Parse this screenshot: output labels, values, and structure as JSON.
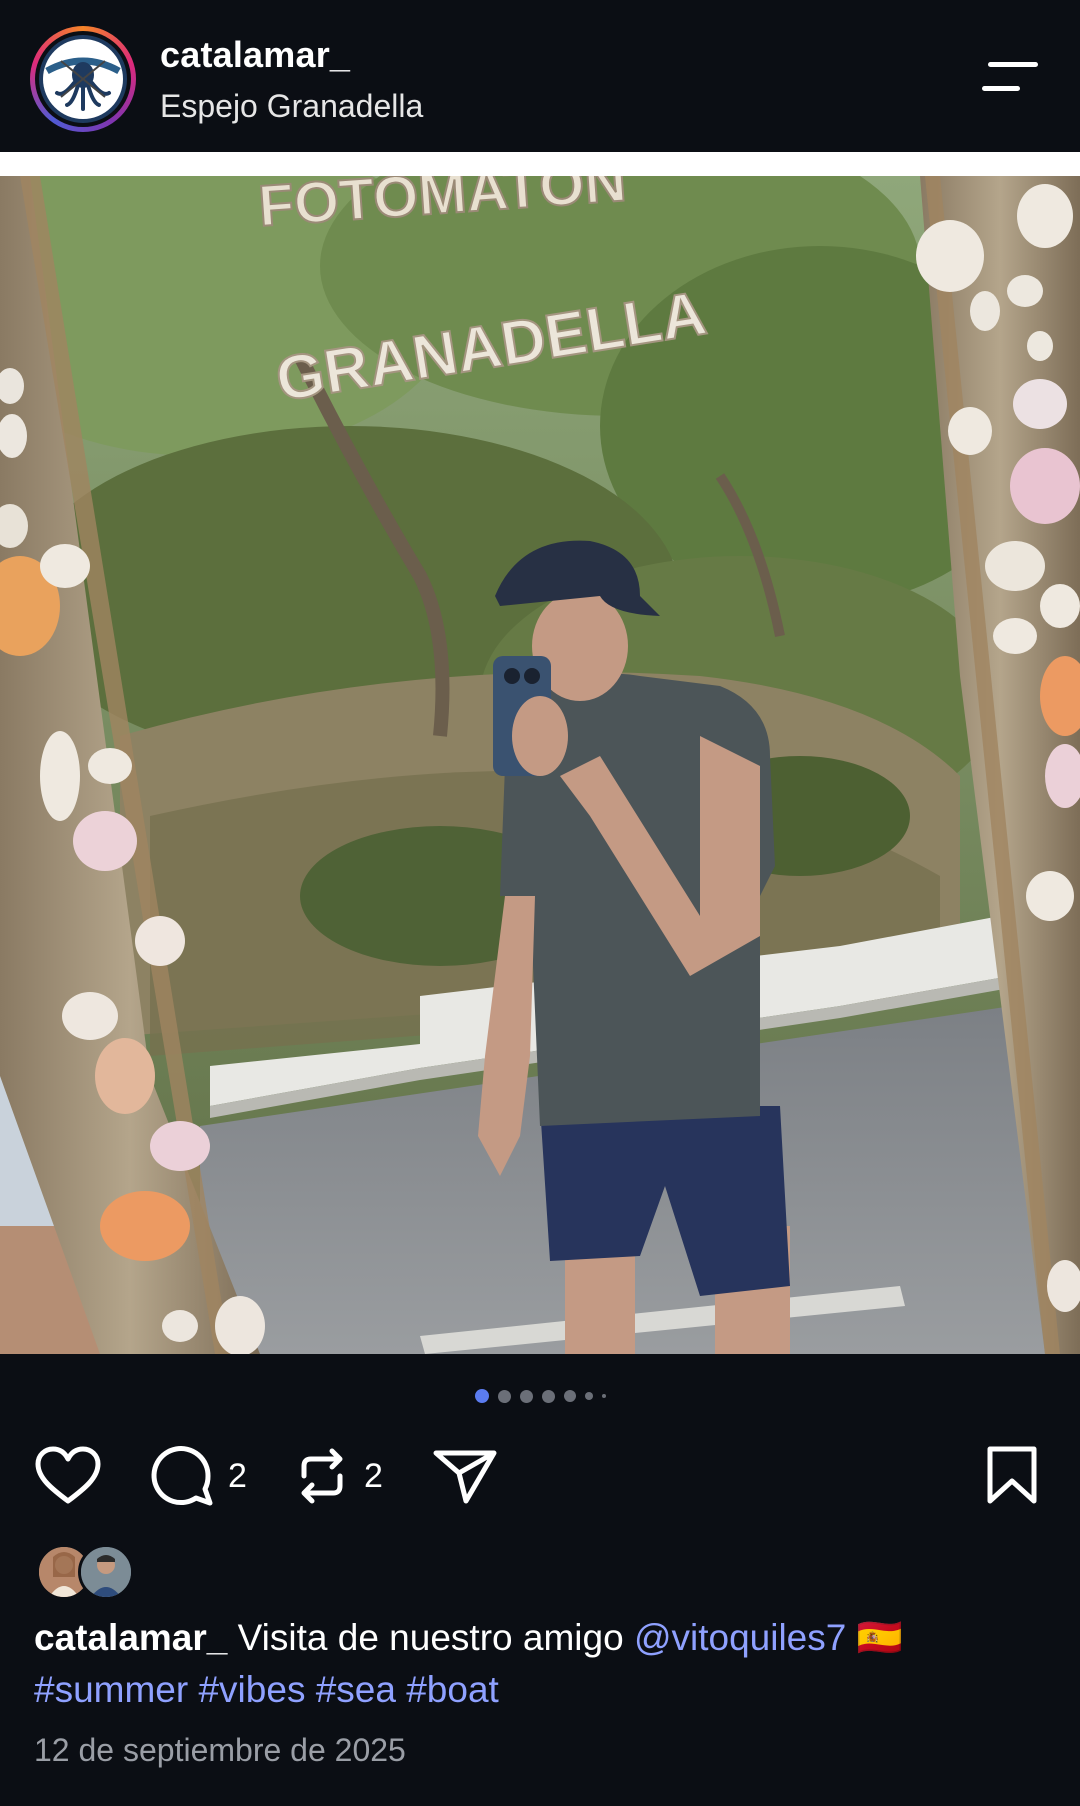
{
  "header": {
    "username": "catalamar_",
    "location": "Espejo Granadella",
    "menu_icon": "hamburger-menu-icon"
  },
  "post": {
    "image_signs": {
      "top": "FOTOMATÓN",
      "main": "GRANADELLA"
    },
    "carousel": {
      "total_dots": 7,
      "active_index": 0
    }
  },
  "actions": {
    "like_icon": "heart-icon",
    "comment_icon": "comment-icon",
    "comment_count": "2",
    "repost_icon": "repost-icon",
    "repost_count": "2",
    "share_icon": "send-icon",
    "save_icon": "bookmark-icon"
  },
  "caption": {
    "username": "catalamar_",
    "text": " Visita de nuestro amigo ",
    "mention": "@vitoquiles7",
    "flag": " 🇪🇸",
    "hashtags": [
      "#summer",
      "#vibes",
      "#sea",
      "#boat"
    ]
  },
  "date": "12 de septiembre de 2025",
  "colors": {
    "background": "#0b0e14",
    "link": "#8fa1ff",
    "dot_active": "#5b7cf0"
  }
}
